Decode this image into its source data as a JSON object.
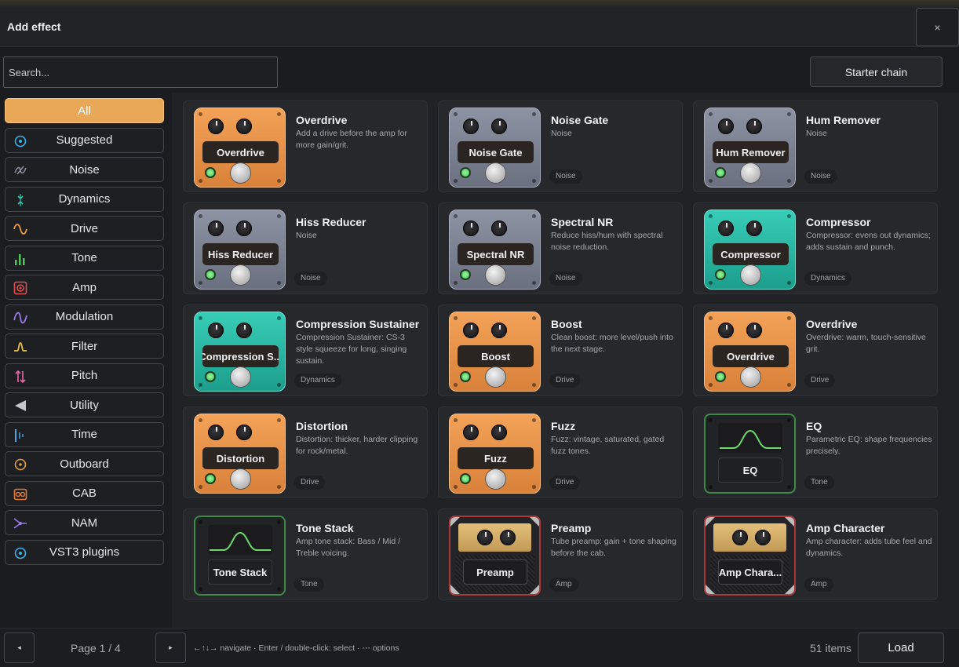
{
  "dialog": {
    "title": "Add effect",
    "close_label": "×"
  },
  "search": {
    "placeholder": "Search..."
  },
  "starter_chain_label": "Starter chain",
  "categories": [
    {
      "label": "All",
      "icon": "none",
      "active": true
    },
    {
      "label": "Suggested",
      "icon": "target-icon",
      "color": "#3ab0e8"
    },
    {
      "label": "Noise",
      "icon": "noise-icon",
      "color": "#8a8f9c"
    },
    {
      "label": "Dynamics",
      "icon": "dynamics-icon",
      "color": "#2cc4b0"
    },
    {
      "label": "Drive",
      "icon": "wave-icon",
      "color": "#f09a3e"
    },
    {
      "label": "Tone",
      "icon": "bars-icon",
      "color": "#4cc65a"
    },
    {
      "label": "Amp",
      "icon": "amp-icon",
      "color": "#e0504f"
    },
    {
      "label": "Modulation",
      "icon": "sine-icon",
      "color": "#9a78e8"
    },
    {
      "label": "Filter",
      "icon": "filter-icon",
      "color": "#e8c23a"
    },
    {
      "label": "Pitch",
      "icon": "pitch-icon",
      "color": "#e86aa8"
    },
    {
      "label": "Utility",
      "icon": "triangle-icon",
      "color": "#c4c6cc"
    },
    {
      "label": "Time",
      "icon": "time-icon",
      "color": "#4aa8e8"
    },
    {
      "label": "Outboard",
      "icon": "outboard-icon",
      "color": "#e0a040"
    },
    {
      "label": "CAB",
      "icon": "cab-icon",
      "color": "#e07a3a"
    },
    {
      "label": "NAM",
      "icon": "nam-icon",
      "color": "#9a78e8"
    },
    {
      "label": "VST3 plugins",
      "icon": "plugin-icon",
      "color": "#3ab0e8"
    }
  ],
  "effects": [
    {
      "name": "Overdrive",
      "desc": "Add a drive before the amp for more gain/grit.",
      "tag": "",
      "style": "orange",
      "label": "Overdrive"
    },
    {
      "name": "Noise Gate",
      "desc": "Noise",
      "tag": "Noise",
      "style": "grey",
      "label": "Noise Gate"
    },
    {
      "name": "Hum Remover",
      "desc": "Noise",
      "tag": "Noise",
      "style": "grey",
      "label": "Hum Remover"
    },
    {
      "name": "Hiss Reducer",
      "desc": "Noise",
      "tag": "Noise",
      "style": "grey",
      "label": "Hiss Reducer"
    },
    {
      "name": "Spectral NR",
      "desc": "Reduce hiss/hum with spectral noise reduction.",
      "tag": "Noise",
      "style": "grey",
      "label": "Spectral NR"
    },
    {
      "name": "Compressor",
      "desc": "Compressor: evens out dynamics; adds sustain and punch.",
      "tag": "Dynamics",
      "style": "teal",
      "label": "Compressor"
    },
    {
      "name": "Compression Sustainer",
      "desc": "Compression Sustainer: CS-3 style squeeze for long, singing sustain.",
      "tag": "Dynamics",
      "style": "teal",
      "label": "Compression S..."
    },
    {
      "name": "Boost",
      "desc": "Clean boost: more level/push into the next stage.",
      "tag": "Drive",
      "style": "orange",
      "label": "Boost"
    },
    {
      "name": "Overdrive",
      "desc": "Overdrive: warm, touch-sensitive grit.",
      "tag": "Drive",
      "style": "orange",
      "label": "Overdrive"
    },
    {
      "name": "Distortion",
      "desc": "Distortion: thicker, harder clipping for rock/metal.",
      "tag": "Drive",
      "style": "orange",
      "label": "Distortion"
    },
    {
      "name": "Fuzz",
      "desc": "Fuzz: vintage, saturated, gated fuzz tones.",
      "tag": "Drive",
      "style": "orange",
      "label": "Fuzz"
    },
    {
      "name": "EQ",
      "desc": "Parametric EQ: shape frequencies precisely.",
      "tag": "Tone",
      "style": "eq",
      "label": "EQ"
    },
    {
      "name": "Tone Stack",
      "desc": "Amp tone stack: Bass / Mid / Treble voicing.",
      "tag": "Tone",
      "style": "eq",
      "label": "Tone Stack"
    },
    {
      "name": "Preamp",
      "desc": "Tube preamp: gain + tone shaping before the cab.",
      "tag": "Amp",
      "style": "amp",
      "label": "Preamp"
    },
    {
      "name": "Amp Character",
      "desc": "Amp character: adds tube feel and dynamics.",
      "tag": "Amp",
      "style": "amp",
      "label": "Amp Chara..."
    }
  ],
  "footer": {
    "prev_label": "◂",
    "next_label": "▸",
    "page_info": "Page 1 / 4",
    "hint": "←↑↓→ navigate · Enter / double-click: select · ⋯ options",
    "count": "51 items",
    "load_label": "Load"
  }
}
